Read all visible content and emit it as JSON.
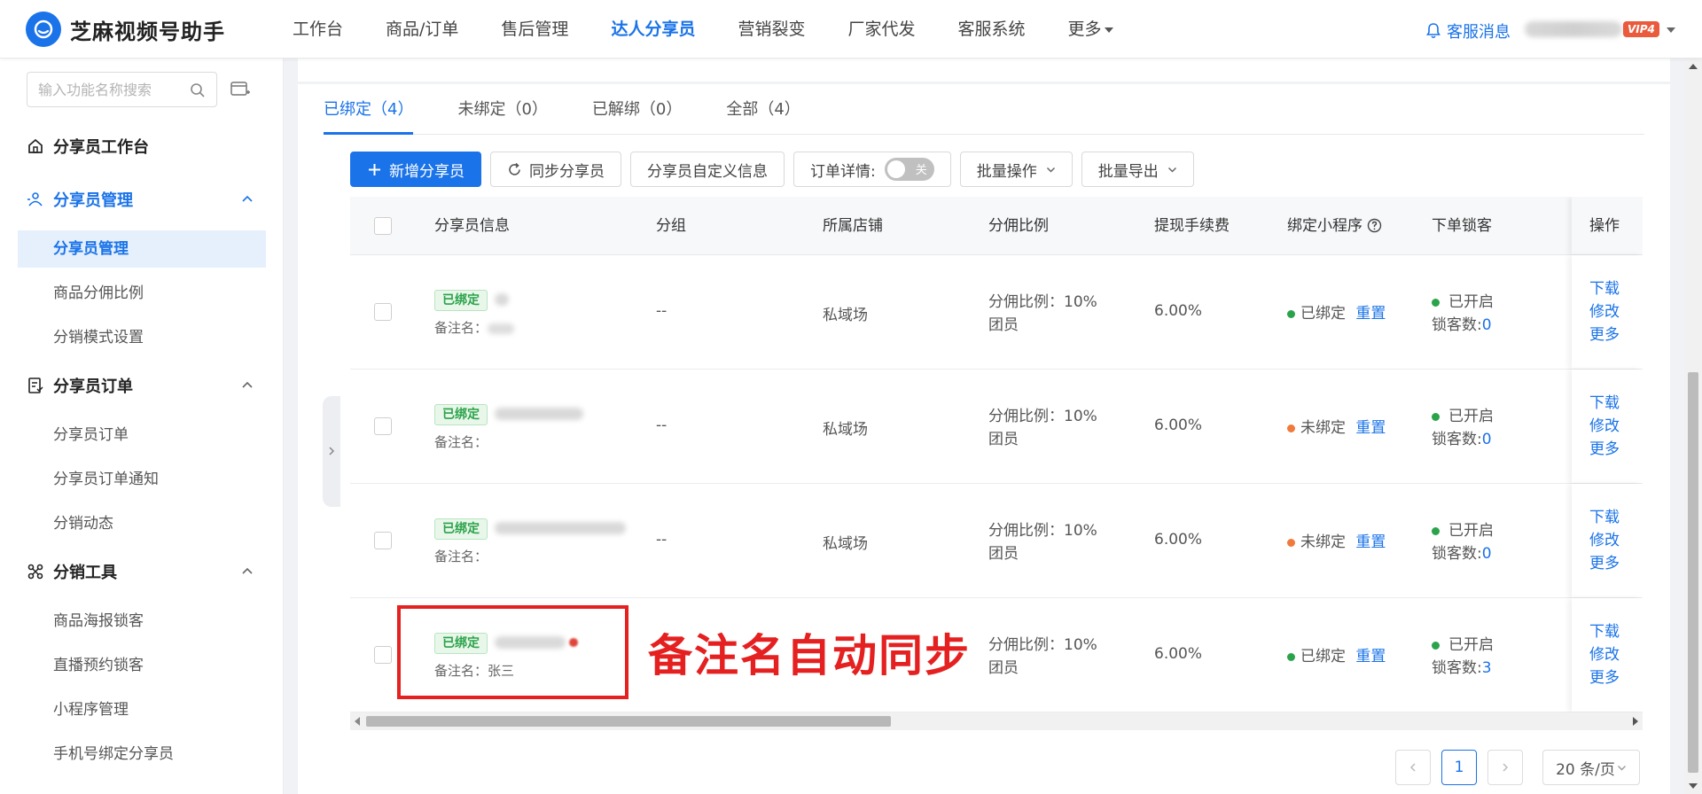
{
  "app": {
    "name": "芝麻视频号助手",
    "brand_color": "#1a73e8"
  },
  "nav": {
    "items": [
      {
        "label": "工作台"
      },
      {
        "label": "商品/订单"
      },
      {
        "label": "售后管理"
      },
      {
        "label": "达人分享员",
        "active": true
      },
      {
        "label": "营销裂变"
      },
      {
        "label": "厂家代发"
      },
      {
        "label": "客服系统"
      },
      {
        "label": "更多"
      }
    ],
    "notice_label": "客服消息",
    "vip_label": "VIP4"
  },
  "sidebar": {
    "search_placeholder": "输入功能名称搜索",
    "workbench": "分享员工作台",
    "groups": [
      {
        "label": "分享员管理",
        "icon": "user-share-icon",
        "items": [
          "分享员管理",
          "商品分佣比例",
          "分销模式设置"
        ]
      },
      {
        "label": "分享员订单",
        "icon": "order-doc-icon",
        "items": [
          "分享员订单",
          "分享员订单通知",
          "分销动态"
        ]
      },
      {
        "label": "分销工具",
        "icon": "tool-icon",
        "items": [
          "商品海报锁客",
          "直播预约锁客",
          "小程序管理",
          "手机号绑定分享员"
        ]
      }
    ]
  },
  "tabs": [
    {
      "label": "已绑定（4）"
    },
    {
      "label": "未绑定（0）"
    },
    {
      "label": "已解绑（0）"
    },
    {
      "label": "全部（4）"
    }
  ],
  "toolbar": {
    "add": "新增分享员",
    "sync": "同步分享员",
    "custom": "分享员自定义信息",
    "order_detail": "订单详情:",
    "toggle_off": "关",
    "batch_op": "批量操作",
    "batch_export": "批量导出"
  },
  "table": {
    "headers": [
      "分享员信息",
      "分组",
      "所属店铺",
      "分佣比例",
      "提现手续费",
      "绑定小程序",
      "下单锁客",
      "操作"
    ],
    "rows": [
      {
        "badge": "已绑定",
        "remark_label": "备注名：",
        "remark_value": "",
        "group": "--",
        "shop": "私域场",
        "ratio": "分佣比例：10%",
        "role": "团员",
        "fee": "6.00%",
        "bind_status": "已绑定",
        "bind_color": "#2ba34a",
        "reset": "重置",
        "lock_status": "已开启",
        "lock_count_label": "锁客数:",
        "lock_count": "0",
        "ops": [
          "下载",
          "修改",
          "更多"
        ]
      },
      {
        "badge": "已绑定",
        "remark_label": "备注名：",
        "remark_value": "",
        "group": "--",
        "shop": "私域场",
        "ratio": "分佣比例：10%",
        "role": "团员",
        "fee": "6.00%",
        "bind_status": "未绑定",
        "bind_color": "#f07a3c",
        "reset": "重置",
        "lock_status": "已开启",
        "lock_count_label": "锁客数:",
        "lock_count": "0",
        "ops": [
          "下载",
          "修改",
          "更多"
        ]
      },
      {
        "badge": "已绑定",
        "remark_label": "备注名：",
        "remark_value": "",
        "group": "--",
        "shop": "私域场",
        "ratio": "分佣比例：10%",
        "role": "团员",
        "fee": "6.00%",
        "bind_status": "未绑定",
        "bind_color": "#f07a3c",
        "reset": "重置",
        "lock_status": "已开启",
        "lock_count_label": "锁客数:",
        "lock_count": "0",
        "ops": [
          "下载",
          "修改",
          "更多"
        ]
      },
      {
        "badge": "已绑定",
        "remark_label": "备注名：",
        "remark_value": "张三",
        "group": "",
        "shop": "",
        "ratio": "分佣比例：10%",
        "role": "团员",
        "fee": "6.00%",
        "bind_status": "已绑定",
        "bind_color": "#2ba34a",
        "reset": "重置",
        "lock_status": "已开启",
        "lock_count_label": "锁客数:",
        "lock_count": "3",
        "ops": [
          "下载",
          "修改",
          "更多"
        ]
      }
    ]
  },
  "annotation": {
    "text": "备注名自动同步",
    "color": "#e52020"
  },
  "pagination": {
    "current": "1",
    "page_size": "20 条/页"
  }
}
